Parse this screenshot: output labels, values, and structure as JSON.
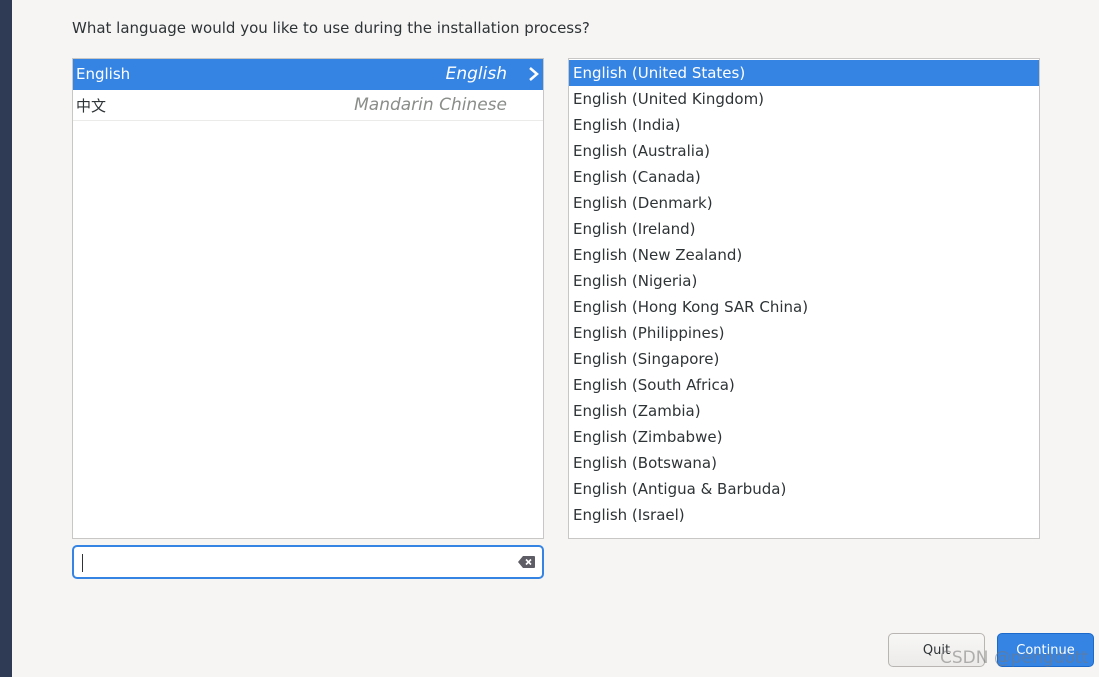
{
  "prompt": "What language would you like to use during the installation process?",
  "languages": [
    {
      "native": "English",
      "english": "English",
      "selected": true
    },
    {
      "native": "中文",
      "english": "Mandarin Chinese",
      "selected": false
    }
  ],
  "locales": [
    "English (United States)",
    "English (United Kingdom)",
    "English (India)",
    "English (Australia)",
    "English (Canada)",
    "English (Denmark)",
    "English (Ireland)",
    "English (New Zealand)",
    "English (Nigeria)",
    "English (Hong Kong SAR China)",
    "English (Philippines)",
    "English (Singapore)",
    "English (South Africa)",
    "English (Zambia)",
    "English (Zimbabwe)",
    "English (Botswana)",
    "English (Antigua & Barbuda)",
    "English (Israel)"
  ],
  "selected_locale": "English (United States)",
  "search": {
    "value": "",
    "clear_icon": "clear-icon"
  },
  "buttons": {
    "quit": "Quit",
    "continue": "Continue"
  },
  "watermark": "CSDN @pengdott",
  "colors": {
    "accent": "#3584e4",
    "background": "#f6f5f4"
  }
}
